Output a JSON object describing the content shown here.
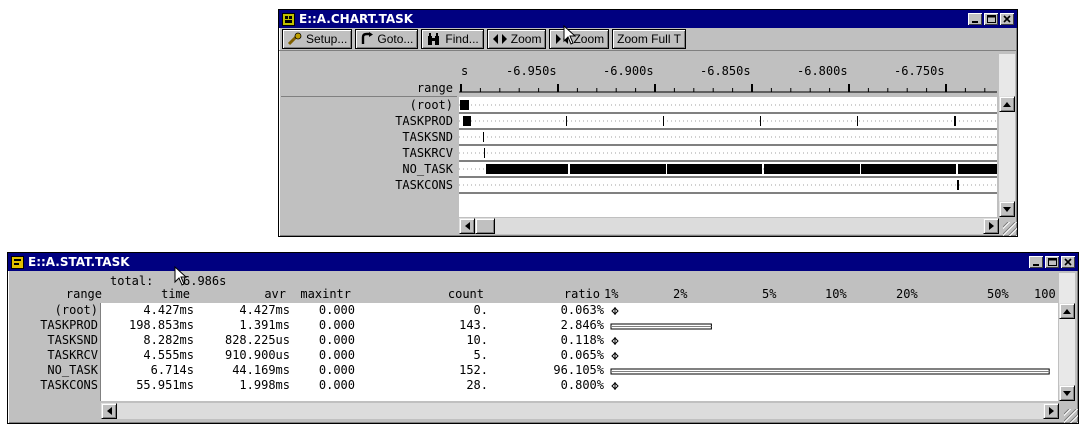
{
  "chart_window": {
    "title": "E::A.CHART.TASK",
    "toolbar": {
      "setup": "Setup...",
      "goto": "Goto...",
      "find": "Find...",
      "zoom_in": "Zoom",
      "zoom_out": "Zoom",
      "zoom_full": "Zoom Full T"
    },
    "time_axis": {
      "unit_label": "s",
      "row_label": "range",
      "ticks": [
        "-6.950s",
        "-6.900s",
        "-6.850s",
        "-6.800s",
        "-6.750s"
      ]
    },
    "rows": [
      "(root)",
      "TASKPROD",
      "TASKSND",
      "TASKRCV",
      "NO_TASK",
      "TASKCONS"
    ]
  },
  "stat_window": {
    "title": "E::A.STAT.TASK",
    "total_label": "total:",
    "total_value": "6.986s",
    "columns": [
      "range",
      "time",
      "avr",
      "maxintr",
      "count",
      "ratio"
    ],
    "scale_labels": [
      "1%",
      "2%",
      "5%",
      "10%",
      "20%",
      "50%",
      "100"
    ],
    "rows": [
      {
        "range": "(root)",
        "time": "4.427ms",
        "avr": "4.427ms",
        "maxintr": "0.000",
        "count": "0.",
        "ratio": "0.063%",
        "ratio_value": 0.063
      },
      {
        "range": "TASKPROD",
        "time": "198.853ms",
        "avr": "1.391ms",
        "maxintr": "0.000",
        "count": "143.",
        "ratio": "2.846%",
        "ratio_value": 2.846
      },
      {
        "range": "TASKSND",
        "time": "8.282ms",
        "avr": "828.225us",
        "maxintr": "0.000",
        "count": "10.",
        "ratio": "0.118%",
        "ratio_value": 0.118
      },
      {
        "range": "TASKRCV",
        "time": "4.555ms",
        "avr": "910.900us",
        "maxintr": "0.000",
        "count": "5.",
        "ratio": "0.065%",
        "ratio_value": 0.065
      },
      {
        "range": "NO_TASK",
        "time": "6.714s",
        "avr": "44.169ms",
        "maxintr": "0.000",
        "count": "152.",
        "ratio": "96.105%",
        "ratio_value": 96.105
      },
      {
        "range": "TASKCONS",
        "time": "55.951ms",
        "avr": "1.998ms",
        "maxintr": "0.000",
        "count": "28.",
        "ratio": "0.800%",
        "ratio_value": 0.8
      }
    ]
  },
  "colors": {
    "titlebar": "#000080",
    "face": "#c0c0c0",
    "bar": "#000000"
  }
}
